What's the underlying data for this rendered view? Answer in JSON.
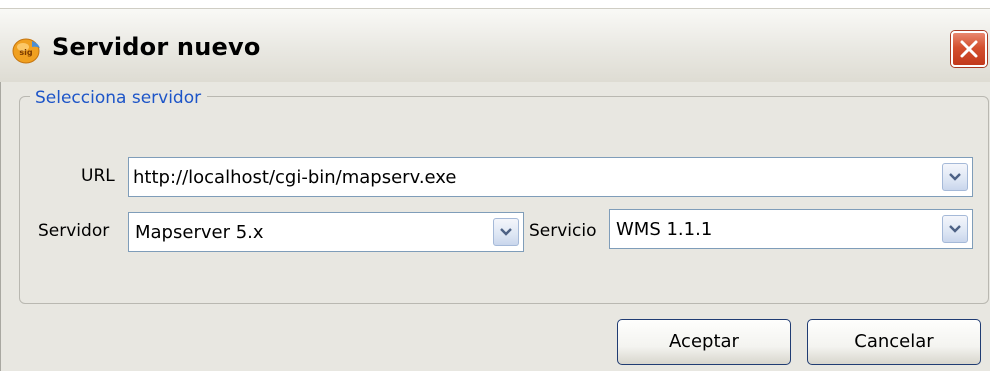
{
  "window": {
    "title": "Servidor nuevo",
    "icon": "gvsig-app-icon",
    "close_icon": "close-icon"
  },
  "group": {
    "legend": "Selecciona servidor"
  },
  "url": {
    "label": "URL",
    "value": "http://localhost/cgi-bin/mapserv.exe"
  },
  "servidor": {
    "label": "Servidor",
    "value": "Mapserver 5.x"
  },
  "servicio": {
    "label": "Servicio",
    "value": "WMS 1.1.1"
  },
  "buttons": {
    "accept": "Aceptar",
    "cancel": "Cancelar"
  },
  "colors": {
    "legend_text": "#1d55c8",
    "close_button": "#c2391b",
    "dialog_background": "#e8e7e1"
  }
}
